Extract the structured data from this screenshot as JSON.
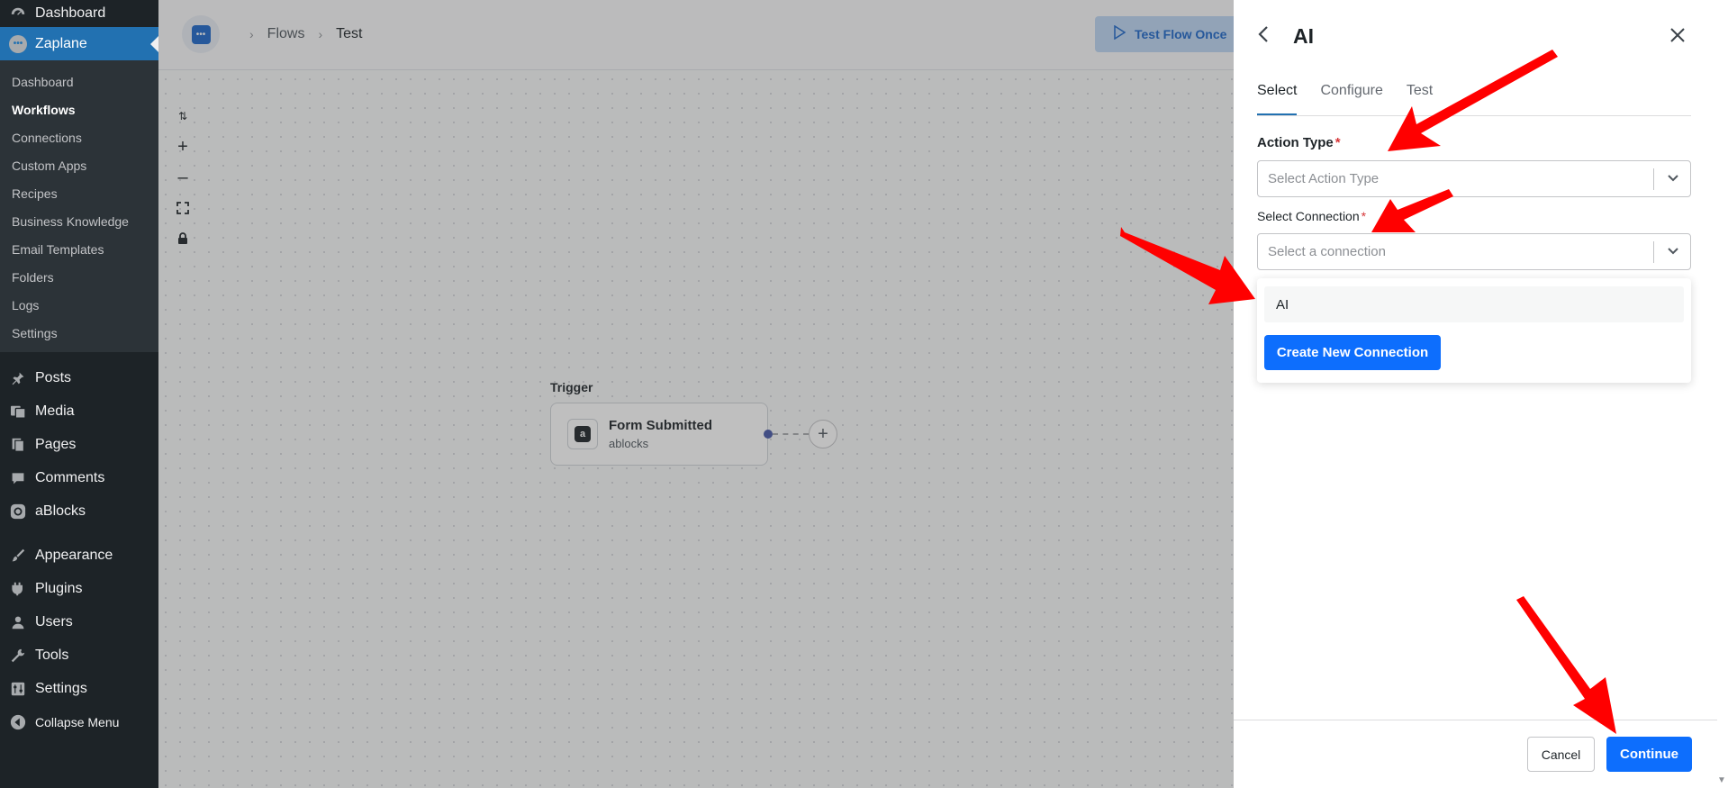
{
  "wp_sidebar": {
    "dashboard": "Dashboard",
    "active_plugin": "Zaplane",
    "submenu": [
      "Dashboard",
      "Workflows",
      "Connections",
      "Custom Apps",
      "Recipes",
      "Business Knowledge",
      "Email Templates",
      "Folders",
      "Logs",
      "Settings"
    ],
    "menu_group1": [
      "Posts",
      "Media",
      "Pages",
      "Comments",
      "aBlocks"
    ],
    "menu_group2": [
      "Appearance",
      "Plugins",
      "Users",
      "Tools",
      "Settings",
      "Collapse Menu"
    ]
  },
  "topbar": {
    "breadcrumb": [
      "Flows",
      "Test"
    ],
    "test_button": "Test Flow Once"
  },
  "canvas": {
    "trigger_label": "Trigger",
    "trigger_title": "Form Submitted",
    "trigger_app": "ablocks"
  },
  "panel": {
    "title": "AI",
    "tabs": [
      "Select",
      "Configure",
      "Test"
    ],
    "action_type_label": "Action Type",
    "action_type_placeholder": "Select Action Type",
    "connection_label": "Select Connection",
    "connection_placeholder": "Select a connection",
    "dropdown_option": "AI",
    "create_button": "Create New Connection",
    "cancel": "Cancel",
    "continue": "Continue"
  },
  "colors": {
    "wp_sidebar": "#1d2327",
    "accent": "#0d6efd",
    "annotation_arrow": "#ff0000"
  }
}
